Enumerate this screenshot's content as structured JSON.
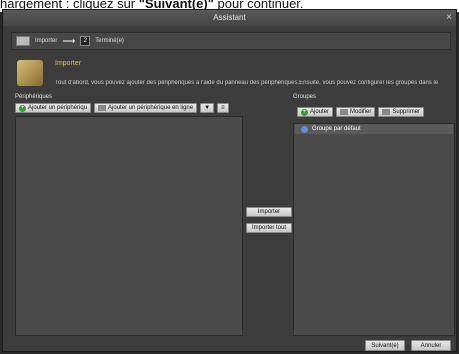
{
  "banner": {
    "text_plain": "hargement : cliquez sur ",
    "text_bold": "\"Suivant(e)\"",
    "text_tail": " pour continuer."
  },
  "window": {
    "title": "Assistant",
    "close": "×"
  },
  "steps": {
    "step1": "Importer",
    "arrow": "⟶",
    "step2_num": "2",
    "step2": "Terminé(e)"
  },
  "header": {
    "title": "Importer",
    "description": "Tout d'abord, vous pouvez ajouter des périphériques à l'aide du panneau des périphériques.Ensuite, vous pouvez configurer les groupes dans le"
  },
  "devices": {
    "label": "Périphériques",
    "add_button": "Ajouter un périphériqu",
    "add_online_button": "Ajouter un périphérique en ligne"
  },
  "middle": {
    "import_button": "Importer",
    "import_all_button": "Importer tout"
  },
  "groups": {
    "label": "Groupes",
    "add_button": "Ajouter",
    "edit_button": "Modifier",
    "delete_button": "Supprimer",
    "items": [
      "Groupe par défaut"
    ]
  },
  "footer": {
    "next_button": "Suivant(e)",
    "cancel_button": "Annuler"
  }
}
